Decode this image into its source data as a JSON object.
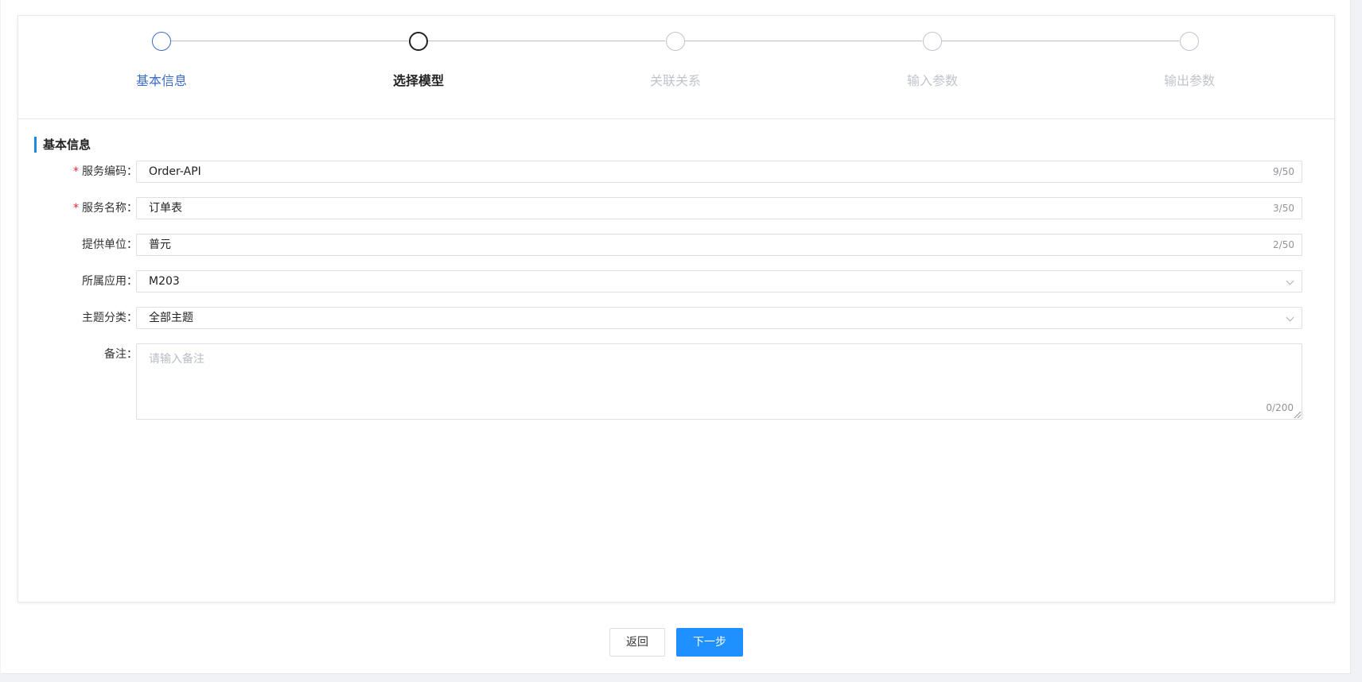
{
  "steps": [
    {
      "label": "基本信息",
      "state": "active"
    },
    {
      "label": "选择模型",
      "state": "current"
    },
    {
      "label": "关联关系",
      "state": "pending"
    },
    {
      "label": "输入参数",
      "state": "pending"
    },
    {
      "label": "输出参数",
      "state": "pending"
    }
  ],
  "section": {
    "title": "基本信息"
  },
  "form": {
    "service_code": {
      "label": "服务编码：",
      "value": "Order-API",
      "count": "9/50"
    },
    "service_name": {
      "label": "服务名称：",
      "value": "订单表",
      "count": "3/50"
    },
    "provider": {
      "label": "提供单位：",
      "value": "普元",
      "count": "2/50"
    },
    "application": {
      "label": "所属应用：",
      "value": "M203"
    },
    "topic": {
      "label": "主题分类：",
      "value": "全部主题"
    },
    "remark": {
      "label": "备注：",
      "placeholder": "请输入备注",
      "count": "0/200"
    }
  },
  "buttons": {
    "back": "返回",
    "next": "下一步"
  },
  "colors": {
    "accent": "#3b6bc8",
    "primary_button": "#1e90ff",
    "required": "#f5222d"
  }
}
